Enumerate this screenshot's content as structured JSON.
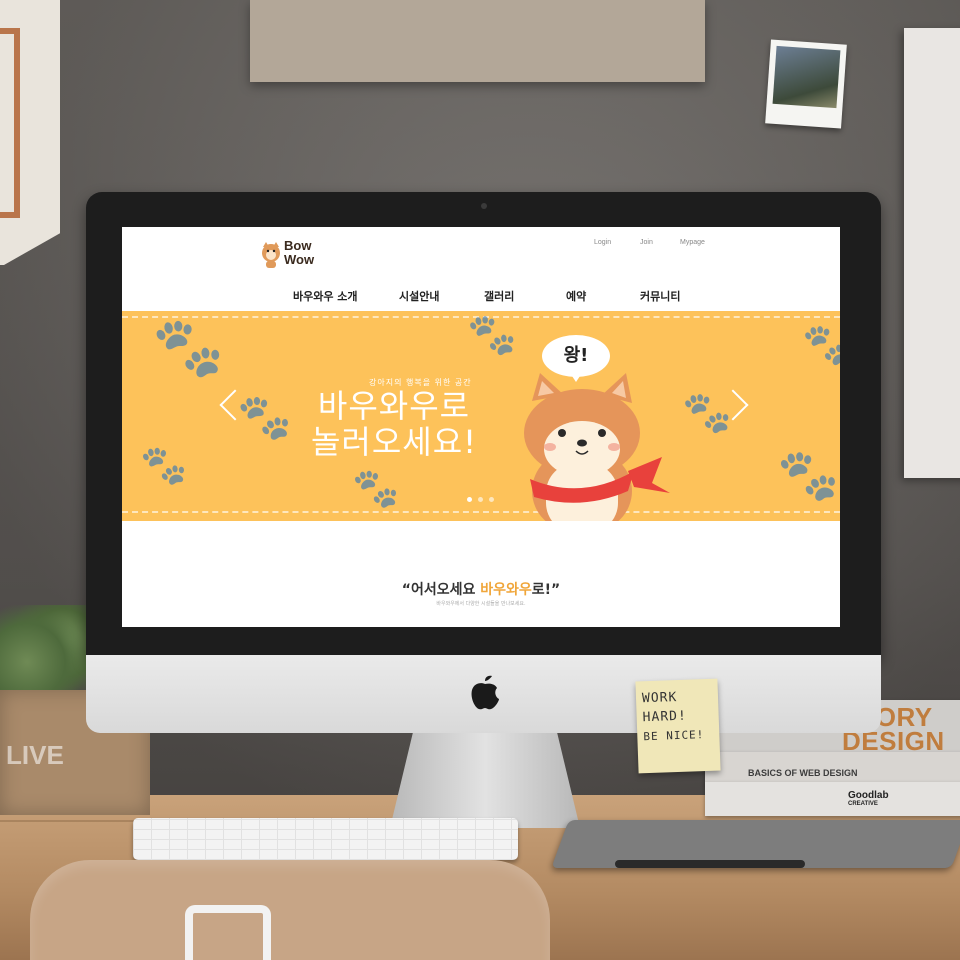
{
  "site": {
    "logo_line1": "Bow",
    "logo_line2": "Wow",
    "util_nav": [
      "Login",
      "Join",
      "Mypage"
    ],
    "main_nav": [
      "바우와우 소개",
      "시설안내",
      "갤러리",
      "예약",
      "커뮤니티"
    ],
    "banner": {
      "subtitle": "강아지의 행복을 위한 공간",
      "title_line1": "바우와우로",
      "title_line2": "놀러오세요!",
      "bubble_text": "왕!",
      "slide_count": 3,
      "active_slide": 1,
      "background_color": "#fdc25a"
    },
    "welcome": {
      "quote_open": "“어서오세요 ",
      "brand": "바우와우",
      "quote_close": "로!”",
      "subtitle": "바우와우에서 다양한 시설들을 만나보세요."
    },
    "accent_color": "#f0a63a"
  },
  "scene": {
    "sticky_note": [
      "WORK",
      "HARD!",
      "BE NICE!"
    ],
    "book_spine_1": [
      "STORY",
      "DESIGN"
    ],
    "book_spine_2": "BASICS OF WEB DESIGN",
    "book_spine_3": [
      "Goodlab",
      "CREATIVE"
    ],
    "plant_box_text": "LIVE"
  }
}
